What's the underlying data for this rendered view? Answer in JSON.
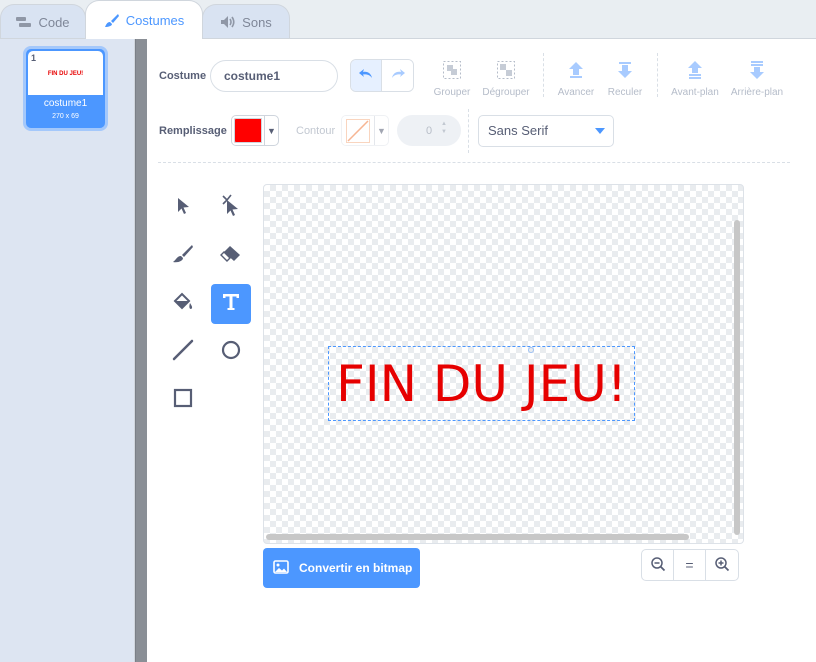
{
  "tabs": [
    {
      "label": "Code",
      "icon": "code-blocks-icon"
    },
    {
      "label": "Costumes",
      "icon": "paintbrush-icon"
    },
    {
      "label": "Sons",
      "icon": "speaker-icon"
    }
  ],
  "costume_list": {
    "items": [
      {
        "number": "1",
        "name": "costume1",
        "size": "270 x 69",
        "thumb_text": "FIN DU JEU!"
      }
    ]
  },
  "toolbar": {
    "costume_label": "Costume",
    "costume_name": "costume1",
    "undo_icon": "undo-icon",
    "redo_icon": "redo-icon",
    "group": "Grouper",
    "ungroup": "Dégrouper",
    "forward": "Avancer",
    "backward": "Reculer",
    "front": "Avant-plan",
    "back": "Arrière-plan",
    "fill_label": "Remplissage",
    "fill_color": "#ff0000",
    "outline_label": "Contour",
    "stroke_width": "0",
    "font": "Sans Serif"
  },
  "canvas": {
    "text": "FIN DU JEU!",
    "text_color": "#e60000"
  },
  "bottom": {
    "bitmap_label": "Convertir en bitmap",
    "zoom_reset": "="
  },
  "colors": {
    "accent": "#4c97ff",
    "text": "#575e75"
  }
}
